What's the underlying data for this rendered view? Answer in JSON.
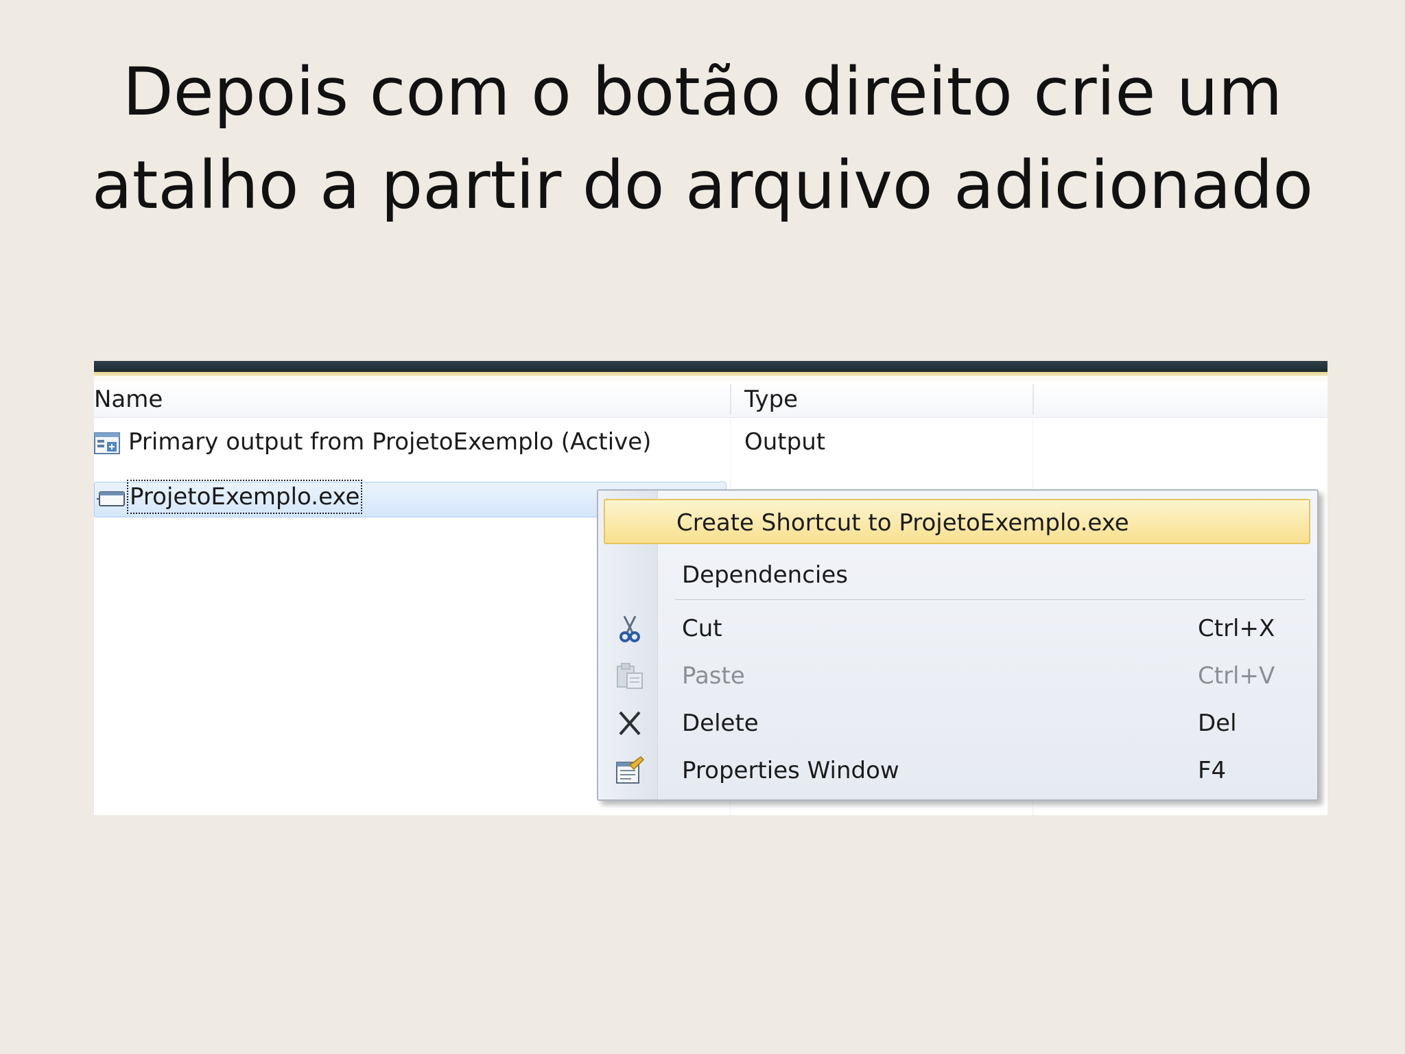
{
  "slide": {
    "title_line1": "Depois com o botão direito crie um",
    "title_line2": "atalho a partir do arquivo adicionado"
  },
  "file_list": {
    "columns": [
      "Name",
      "Type"
    ],
    "rows": [
      {
        "name": "Primary output from ProjetoExemplo (Active)",
        "type": "Output",
        "icon": "project-output-icon"
      },
      {
        "name": "ProjetoExemplo.exe",
        "type": "",
        "icon": "exe-file-icon",
        "selected": true
      }
    ]
  },
  "context_menu": {
    "items": [
      {
        "label": "Create Shortcut to ProjetoExemplo.exe",
        "shortcut": "",
        "icon": "",
        "highlighted": true
      },
      {
        "label": "Dependencies",
        "shortcut": "",
        "icon": ""
      },
      {
        "label": "Cut",
        "shortcut": "Ctrl+X",
        "icon": "scissors-icon"
      },
      {
        "label": "Paste",
        "shortcut": "Ctrl+V",
        "icon": "clipboard-icon",
        "disabled": true
      },
      {
        "label": "Delete",
        "shortcut": "Del",
        "icon": "delete-x-icon"
      },
      {
        "label": "Properties Window",
        "shortcut": "F4",
        "icon": "properties-icon"
      }
    ]
  },
  "colors": {
    "slide_background": "#efebe3",
    "menu_highlight": "#f8e08e",
    "selection": "#d5e7fb"
  }
}
